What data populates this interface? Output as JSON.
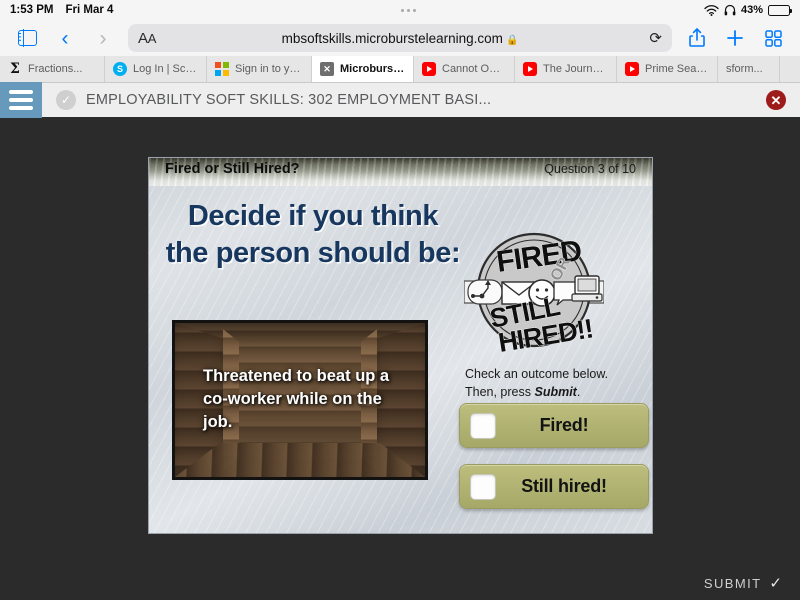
{
  "status_bar": {
    "time": "1:53 PM",
    "date": "Fri Mar 4",
    "battery_percent": "43%",
    "wifi_icon": "wifi-icon",
    "headphones_icon": "headphones-icon",
    "battery_icon": "battery-icon"
  },
  "browser": {
    "sidebar_icon": "sidebar-icon",
    "back_icon": "chevron-left-icon",
    "forward_icon": "chevron-right-icon",
    "text_size_label": "AA",
    "url": "mbsoftskills.microburstelearning.com",
    "lock_icon": "lock-icon",
    "reload_icon": "reload-icon",
    "share_icon": "share-icon",
    "new_tab_icon": "plus-icon",
    "tab_overview_icon": "tab-overview-icon"
  },
  "tabs": [
    {
      "label": "Fractions...",
      "favicon": "sigma-icon",
      "active": false
    },
    {
      "label": "Log In | Scho...",
      "favicon": "skype-icon",
      "active": false
    },
    {
      "label": "Sign in to yo...",
      "favicon": "microsoft-icon",
      "active": false
    },
    {
      "label": "Microburst L...",
      "favicon": "close-box-icon",
      "active": true
    },
    {
      "label": "Cannot Ope...",
      "favicon": "youtube-icon",
      "active": false
    },
    {
      "label": "The Journey...",
      "favicon": "youtube-icon",
      "active": false
    },
    {
      "label": "Prime Seaso...",
      "favicon": "youtube-icon",
      "active": false
    },
    {
      "label": "sform...",
      "favicon": "none",
      "active": false
    }
  ],
  "app_header": {
    "menu_icon": "hamburger-menu-icon",
    "status_icon": "check-circle-icon",
    "title": "EMPLOYABILITY SOFT SKILLS: 302 EMPLOYMENT BASI...",
    "close_icon": "close-circle-icon",
    "close_glyph": "✕",
    "accent_color": "#6699bb",
    "close_color": "#9e1b1b"
  },
  "slide": {
    "header_title": "Fired or Still Hired?",
    "question_counter": "Question 3 of 10",
    "prompt": "Decide if you think the person should be:",
    "scenario": "Threatened to beat up a co-worker while on the job.",
    "instructions_line1": "Check an outcome below.",
    "instructions_line2_prefix": "Then, press ",
    "instructions_line2_emphasis": "Submit",
    "instructions_line2_suffix": ".",
    "logo": {
      "line1": "FIRED",
      "line2": "OR",
      "line3": "STILL",
      "line4": "HIRED!!"
    },
    "answers": [
      {
        "label": "Fired!",
        "checked": false
      },
      {
        "label": "Still hired!",
        "checked": false
      }
    ],
    "prompt_color": "#17375e",
    "answer_color": "#b2b473"
  },
  "footer": {
    "submit_label": "SUBMIT",
    "submit_check": "✓"
  }
}
